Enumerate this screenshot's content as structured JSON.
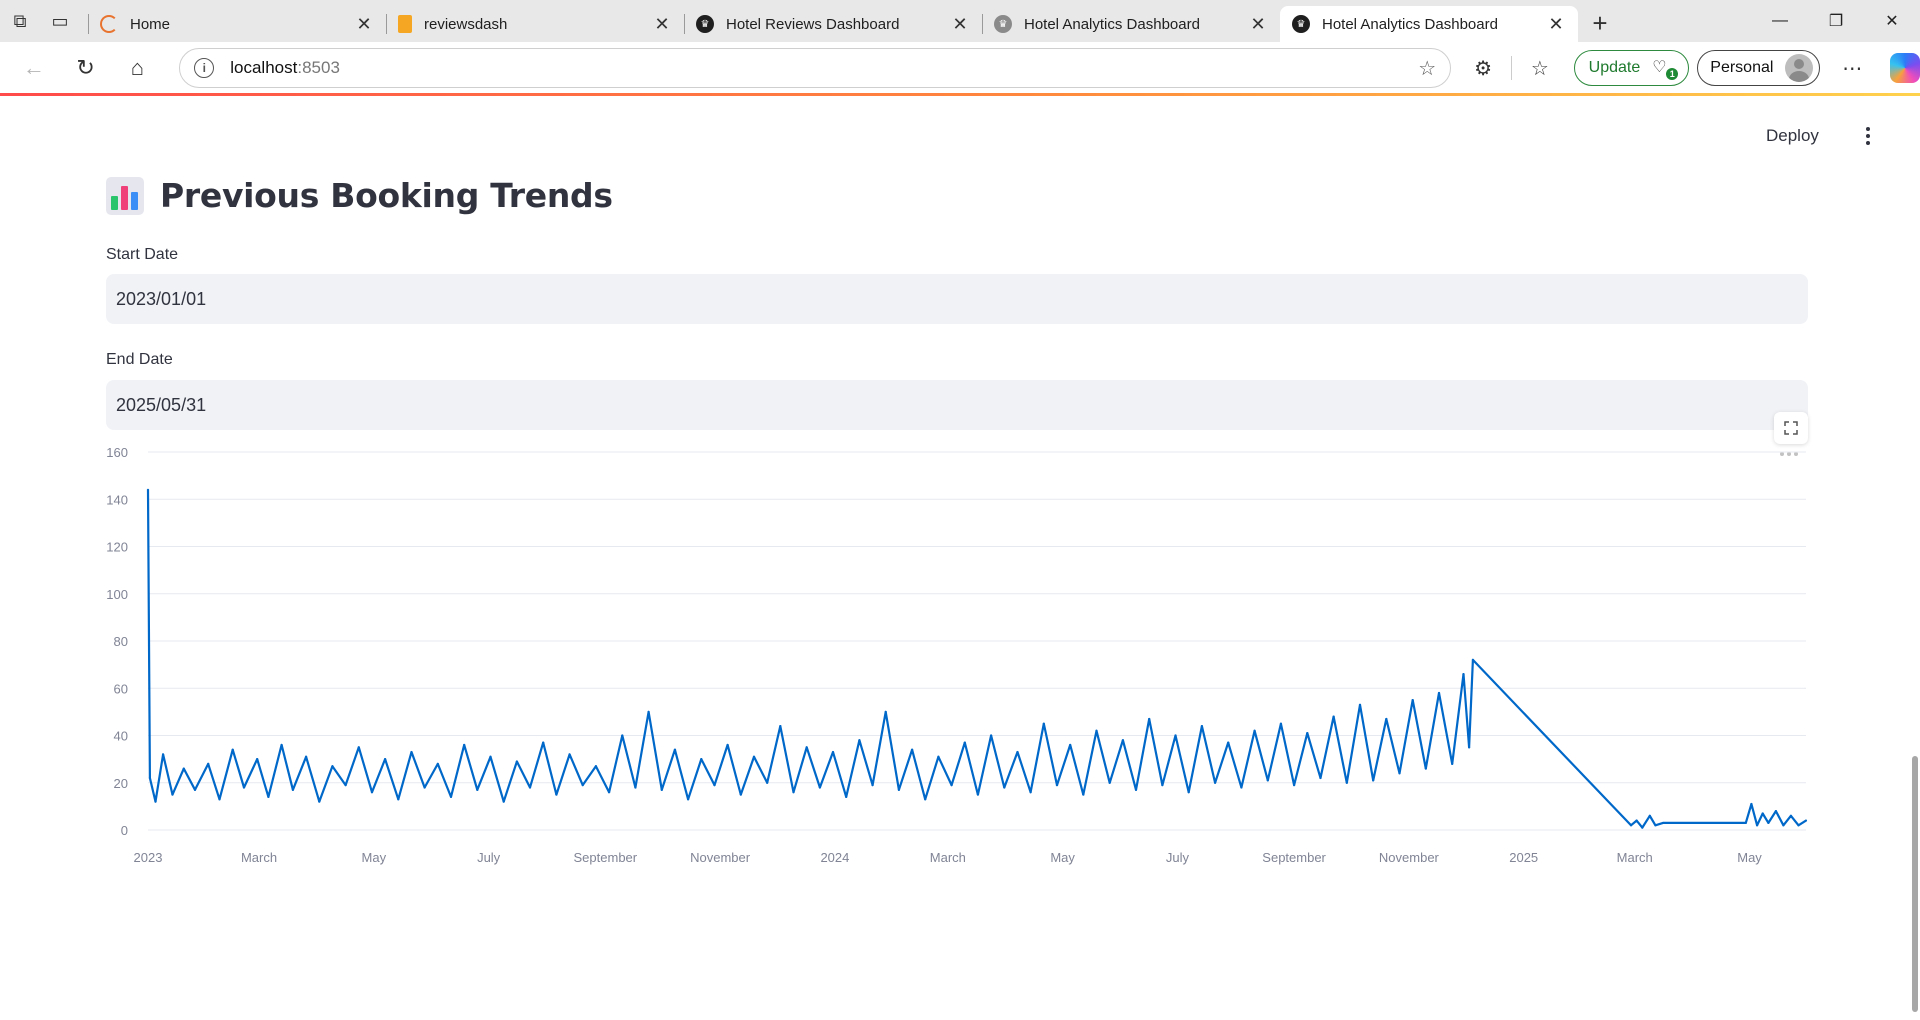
{
  "browser": {
    "tabs": [
      {
        "title": "Home",
        "favicon": "loading-icon",
        "color": "#e8732f"
      },
      {
        "title": "reviewsdash",
        "favicon": "book-icon",
        "color": "#f5a623"
      },
      {
        "title": "Hotel Reviews Dashboard",
        "favicon": "streamlit-crown-icon",
        "color": "#1f1f1f"
      },
      {
        "title": "Hotel Analytics Dashboard",
        "favicon": "streamlit-crown-icon",
        "color": "#7a7a7a"
      },
      {
        "title": "Hotel Analytics Dashboard",
        "favicon": "streamlit-crown-icon",
        "color": "#1f1f1f",
        "active": true
      }
    ],
    "url_host": "localhost",
    "url_port": ":8503",
    "update_label": "Update",
    "update_badge": "1",
    "profile_label": "Personal"
  },
  "app": {
    "deploy_label": "Deploy",
    "title": "Previous Booking Trends",
    "title_emoji": "bar-chart-icon",
    "start_date_label": "Start Date",
    "start_date_value": "2023/01/01",
    "end_date_label": "End Date",
    "end_date_value": "2025/05/31"
  },
  "chart_data": {
    "type": "line",
    "title": "",
    "xlabel": "",
    "ylabel": "",
    "ylim": [
      0,
      160
    ],
    "yticks": [
      0,
      20,
      40,
      60,
      80,
      100,
      120,
      140,
      160
    ],
    "xlim": [
      "2023-01-01",
      "2025-05-31"
    ],
    "xticks": [
      {
        "date": "2023-01-01",
        "label": "2023"
      },
      {
        "date": "2023-03-01",
        "label": "March"
      },
      {
        "date": "2023-05-01",
        "label": "May"
      },
      {
        "date": "2023-07-01",
        "label": "July"
      },
      {
        "date": "2023-09-01",
        "label": "September"
      },
      {
        "date": "2023-11-01",
        "label": "November"
      },
      {
        "date": "2024-01-01",
        "label": "2024"
      },
      {
        "date": "2024-03-01",
        "label": "March"
      },
      {
        "date": "2024-05-01",
        "label": "May"
      },
      {
        "date": "2024-07-01",
        "label": "July"
      },
      {
        "date": "2024-09-01",
        "label": "September"
      },
      {
        "date": "2024-11-01",
        "label": "November"
      },
      {
        "date": "2025-01-01",
        "label": "2025"
      },
      {
        "date": "2025-03-01",
        "label": "March"
      },
      {
        "date": "2025-05-01",
        "label": "May"
      }
    ],
    "grid": true,
    "line_color": "#0068c9",
    "series": [
      {
        "values_note": "approximate daily booking counts read from the figure",
        "points": [
          [
            "2023-01-01",
            144
          ],
          [
            "2023-01-02",
            22
          ],
          [
            "2023-01-05",
            12
          ],
          [
            "2023-01-09",
            32
          ],
          [
            "2023-01-14",
            15
          ],
          [
            "2023-01-20",
            26
          ],
          [
            "2023-01-26",
            17
          ],
          [
            "2023-02-02",
            28
          ],
          [
            "2023-02-08",
            13
          ],
          [
            "2023-02-15",
            34
          ],
          [
            "2023-02-21",
            18
          ],
          [
            "2023-02-28",
            30
          ],
          [
            "2023-03-06",
            14
          ],
          [
            "2023-03-13",
            36
          ],
          [
            "2023-03-19",
            17
          ],
          [
            "2023-03-26",
            31
          ],
          [
            "2023-04-02",
            12
          ],
          [
            "2023-04-09",
            27
          ],
          [
            "2023-04-16",
            19
          ],
          [
            "2023-04-23",
            35
          ],
          [
            "2023-04-30",
            16
          ],
          [
            "2023-05-07",
            30
          ],
          [
            "2023-05-14",
            13
          ],
          [
            "2023-05-21",
            33
          ],
          [
            "2023-05-28",
            18
          ],
          [
            "2023-06-04",
            28
          ],
          [
            "2023-06-11",
            14
          ],
          [
            "2023-06-18",
            36
          ],
          [
            "2023-06-25",
            17
          ],
          [
            "2023-07-02",
            31
          ],
          [
            "2023-07-09",
            12
          ],
          [
            "2023-07-16",
            29
          ],
          [
            "2023-07-23",
            18
          ],
          [
            "2023-07-30",
            37
          ],
          [
            "2023-08-06",
            15
          ],
          [
            "2023-08-13",
            32
          ],
          [
            "2023-08-20",
            19
          ],
          [
            "2023-08-27",
            27
          ],
          [
            "2023-09-03",
            16
          ],
          [
            "2023-09-10",
            40
          ],
          [
            "2023-09-17",
            18
          ],
          [
            "2023-09-24",
            50
          ],
          [
            "2023-10-01",
            17
          ],
          [
            "2023-10-08",
            34
          ],
          [
            "2023-10-15",
            13
          ],
          [
            "2023-10-22",
            30
          ],
          [
            "2023-10-29",
            19
          ],
          [
            "2023-11-05",
            36
          ],
          [
            "2023-11-12",
            15
          ],
          [
            "2023-11-19",
            31
          ],
          [
            "2023-11-26",
            20
          ],
          [
            "2023-12-03",
            44
          ],
          [
            "2023-12-10",
            16
          ],
          [
            "2023-12-17",
            35
          ],
          [
            "2023-12-24",
            18
          ],
          [
            "2023-12-31",
            33
          ],
          [
            "2024-01-07",
            14
          ],
          [
            "2024-01-14",
            38
          ],
          [
            "2024-01-21",
            19
          ],
          [
            "2024-01-28",
            50
          ],
          [
            "2024-02-04",
            17
          ],
          [
            "2024-02-11",
            34
          ],
          [
            "2024-02-18",
            13
          ],
          [
            "2024-02-25",
            31
          ],
          [
            "2024-03-03",
            19
          ],
          [
            "2024-03-10",
            37
          ],
          [
            "2024-03-17",
            15
          ],
          [
            "2024-03-24",
            40
          ],
          [
            "2024-03-31",
            18
          ],
          [
            "2024-04-07",
            33
          ],
          [
            "2024-04-14",
            16
          ],
          [
            "2024-04-21",
            45
          ],
          [
            "2024-04-28",
            19
          ],
          [
            "2024-05-05",
            36
          ],
          [
            "2024-05-12",
            15
          ],
          [
            "2024-05-19",
            42
          ],
          [
            "2024-05-26",
            20
          ],
          [
            "2024-06-02",
            38
          ],
          [
            "2024-06-09",
            17
          ],
          [
            "2024-06-16",
            47
          ],
          [
            "2024-06-23",
            19
          ],
          [
            "2024-06-30",
            40
          ],
          [
            "2024-07-07",
            16
          ],
          [
            "2024-07-14",
            44
          ],
          [
            "2024-07-21",
            20
          ],
          [
            "2024-07-28",
            37
          ],
          [
            "2024-08-04",
            18
          ],
          [
            "2024-08-11",
            42
          ],
          [
            "2024-08-18",
            21
          ],
          [
            "2024-08-25",
            45
          ],
          [
            "2024-09-01",
            19
          ],
          [
            "2024-09-08",
            41
          ],
          [
            "2024-09-15",
            22
          ],
          [
            "2024-09-22",
            48
          ],
          [
            "2024-09-29",
            20
          ],
          [
            "2024-10-06",
            53
          ],
          [
            "2024-10-13",
            21
          ],
          [
            "2024-10-20",
            47
          ],
          [
            "2024-10-27",
            24
          ],
          [
            "2024-11-03",
            55
          ],
          [
            "2024-11-10",
            26
          ],
          [
            "2024-11-17",
            58
          ],
          [
            "2024-11-24",
            28
          ],
          [
            "2024-11-30",
            66
          ],
          [
            "2024-12-03",
            35
          ],
          [
            "2024-12-05",
            72
          ],
          [
            "2025-02-27",
            2
          ],
          [
            "2025-03-02",
            4
          ],
          [
            "2025-03-05",
            1
          ],
          [
            "2025-03-09",
            6
          ],
          [
            "2025-03-12",
            2
          ],
          [
            "2025-03-16",
            3
          ],
          [
            "2025-04-29",
            3
          ],
          [
            "2025-05-02",
            11
          ],
          [
            "2025-05-05",
            2
          ],
          [
            "2025-05-08",
            7
          ],
          [
            "2025-05-11",
            3
          ],
          [
            "2025-05-15",
            8
          ],
          [
            "2025-05-19",
            2
          ],
          [
            "2025-05-23",
            6
          ],
          [
            "2025-05-27",
            2
          ],
          [
            "2025-05-31",
            4
          ]
        ]
      }
    ]
  }
}
